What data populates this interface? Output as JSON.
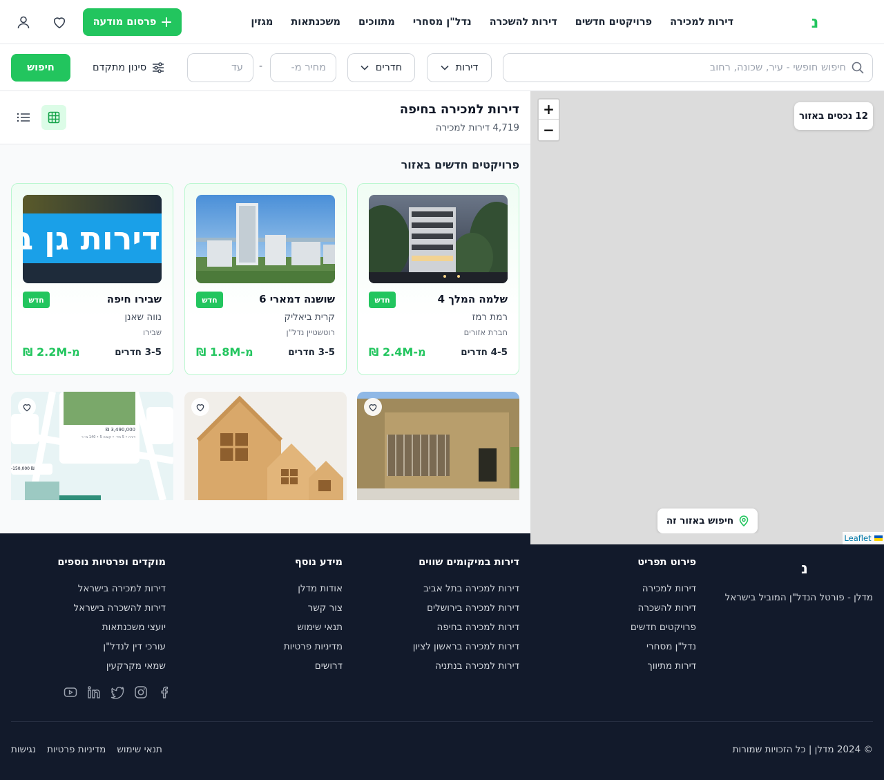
{
  "header": {
    "logo": "נ",
    "nav": [
      "דירות למכירה",
      "פרויקטים חדשים",
      "דירות להשכרה",
      "נדל\"ן מסחרי",
      "מתווכים",
      "משכנתאות",
      "מגזין"
    ],
    "post_button": "פרסום מודעה"
  },
  "search": {
    "placeholder": "חיפוש חופשי - עיר, שכונה, רחוב",
    "property_type": "דירות",
    "rooms": "חדרים",
    "price_from_placeholder": "מחיר מ-",
    "price_to_placeholder": "עד",
    "dash": "-",
    "advanced_filter": "סינון מתקדם",
    "search_button": "חיפוש"
  },
  "listing": {
    "title": "דירות למכירה בחיפה",
    "count": "4,719 דירות למכירה",
    "section_title": "פרויקטים חדשים באזור",
    "projects": [
      {
        "name": "שלמה המלך 4",
        "badge": "חדש",
        "area": "רמת רמז",
        "developer": "חברת אזורים",
        "rooms": "4-5 חדרים",
        "price": "מ-2.4M ₪"
      },
      {
        "name": "שושנה דמארי 6",
        "badge": "חדש",
        "area": "קרית ביאליק",
        "developer": "רוטשטיין נדל\"ן",
        "rooms": "3-5 חדרים",
        "price": "מ-1.8M ₪"
      },
      {
        "name": "שבירו חיפה",
        "badge": "חדש",
        "area": "נווה שאנן",
        "developer": "שבירו",
        "rooms": "3-5 חדרים",
        "price": "מ-2.2M ₪",
        "image_text": "דירות גן בלב"
      }
    ],
    "ad_card": {
      "price": "3,490,000 ₪",
      "details": "דירה • 5 חד׳ • קומה 5 • 140 מ״ר",
      "badge": "-150,000 ₪"
    }
  },
  "map": {
    "zoom_in": "+",
    "zoom_out": "−",
    "count_number": "12",
    "count_label": "נכסים באזור",
    "search_area": "חיפוש באזור זה",
    "attribution": "Leaflet"
  },
  "footer": {
    "logo": "נ",
    "tagline": "מדלן - פורטל הנדל\"ן המוביל בישראל",
    "columns": [
      {
        "title": "פירוט תפריט",
        "links": [
          "דירות למכירה",
          "דירות להשכרה",
          "פרויקטים חדשים",
          "נדל\"ן מסחרי",
          "דירות מתיווך"
        ]
      },
      {
        "title": "דירות במיקומים שווים",
        "links": [
          "דירות למכירה בתל אביב",
          "דירות למכירה בירושלים",
          "דירות למכירה בחיפה",
          "דירות למכירה בראשון לציון",
          "דירות למכירה בנתניה"
        ]
      },
      {
        "title": "מידע נוסף",
        "links": [
          "אודות מדלן",
          "צור קשר",
          "תנאי שימוש",
          "מדיניות פרטיות",
          "דרושים"
        ]
      },
      {
        "title": "מוקדים ופרטיות נוספים",
        "links": [
          "דירות למכירה בישראל",
          "דירות להשכרה בישראל",
          "יועצי משכנתאות",
          "עורכי דין לנדל\"ן",
          "שמאי מקרקעין"
        ]
      }
    ],
    "copyright": "© 2024 מדלן | כל הזכויות שמורות",
    "legal": [
      "תנאי שימוש",
      "מדיניות פרטיות",
      "נגישות"
    ]
  },
  "colors": {
    "brand": "#22c55e",
    "footer_bg": "#121a2b",
    "map_bg": "#dcdcdc"
  }
}
